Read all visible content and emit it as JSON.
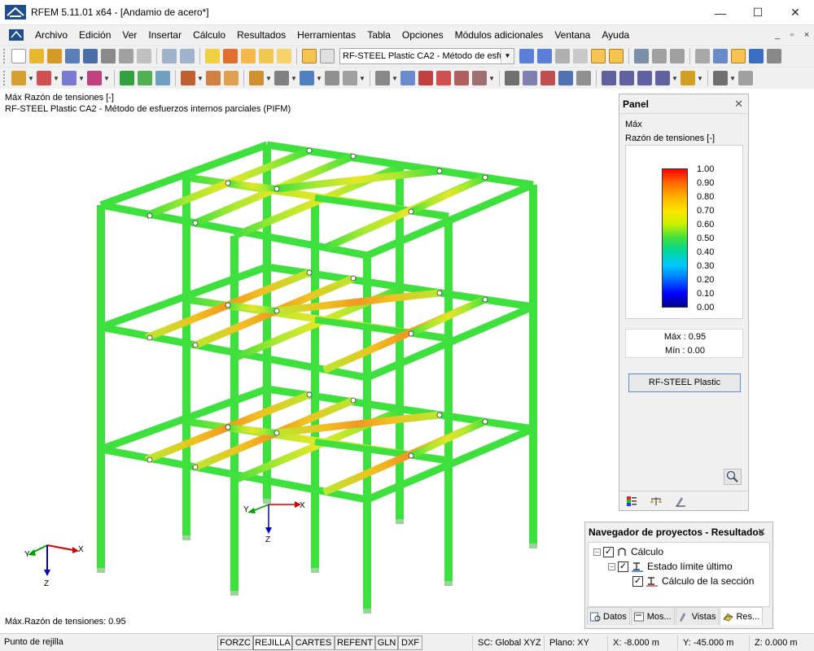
{
  "window": {
    "title": "RFEM 5.11.01 x64 - [Andamio de acero*]",
    "controls": {
      "minimize": "—",
      "maximize": "☐",
      "close": "✕"
    }
  },
  "menu": {
    "items": [
      "Archivo",
      "Edición",
      "Ver",
      "Insertar",
      "Cálculo",
      "Resultados",
      "Herramientas",
      "Tabla",
      "Opciones",
      "Módulos adicionales",
      "Ventana",
      "Ayuda"
    ],
    "doc_controls": {
      "minimize": "_",
      "restore": "▫",
      "close": "×"
    }
  },
  "toolbar1": {
    "combo_value": "RF-STEEL Plastic CA2 - Método de esfu",
    "combo_arrow": "▼"
  },
  "viewport": {
    "line1": "Máx Razón de tensiones [-]",
    "line2": "RF-STEEL Plastic CA2 - Método de esfuerzos internos parciales (PIFM)",
    "footer": "Máx.Razón de tensiones: 0.95",
    "axes_main": {
      "x": "X",
      "y": "Y",
      "z": "Z"
    },
    "axes_model": {
      "x": "X",
      "y": "Y",
      "z": "Z"
    }
  },
  "panel": {
    "title": "Panel",
    "close": "✕",
    "subtitle1": "Máx",
    "subtitle2": "Razón de tensiones [-]",
    "legend": [
      "1.00",
      "0.90",
      "0.80",
      "0.70",
      "0.60",
      "0.50",
      "0.40",
      "0.30",
      "0.20",
      "0.10",
      "0.00"
    ],
    "max_label": "Máx  :  0.95",
    "min_label": "Mín  :  0.00",
    "button": "RF-STEEL Plastic"
  },
  "navigator": {
    "title": "Navegador de proyectos - Resultados",
    "close": "✕",
    "nodes": [
      "Cálculo",
      "Estado límite último",
      "Cálculo de la sección"
    ],
    "check": "✓",
    "collapse": "−",
    "tabs": [
      "Datos",
      "Mos...",
      "Vistas",
      "Res..."
    ]
  },
  "statusbar": {
    "left": "Punto de rejilla",
    "buttons": [
      "FORZC",
      "REJILLA",
      "CARTES",
      "REFENT",
      "GLN",
      "DXF"
    ],
    "active": "REJILLA",
    "sc": "SC: Global XYZ",
    "plane": "Plano: XY",
    "x": "X:  -8.000 m",
    "y": "Y:  -45.000 m",
    "z": "Z:  0.000 m"
  },
  "colors": {
    "member_green": "#3ee03e",
    "member_yellow": "#e4e628",
    "member_orange": "#f0a020",
    "axis_x": "#d00000",
    "axis_y": "#00a000",
    "axis_z": "#0000c0"
  }
}
